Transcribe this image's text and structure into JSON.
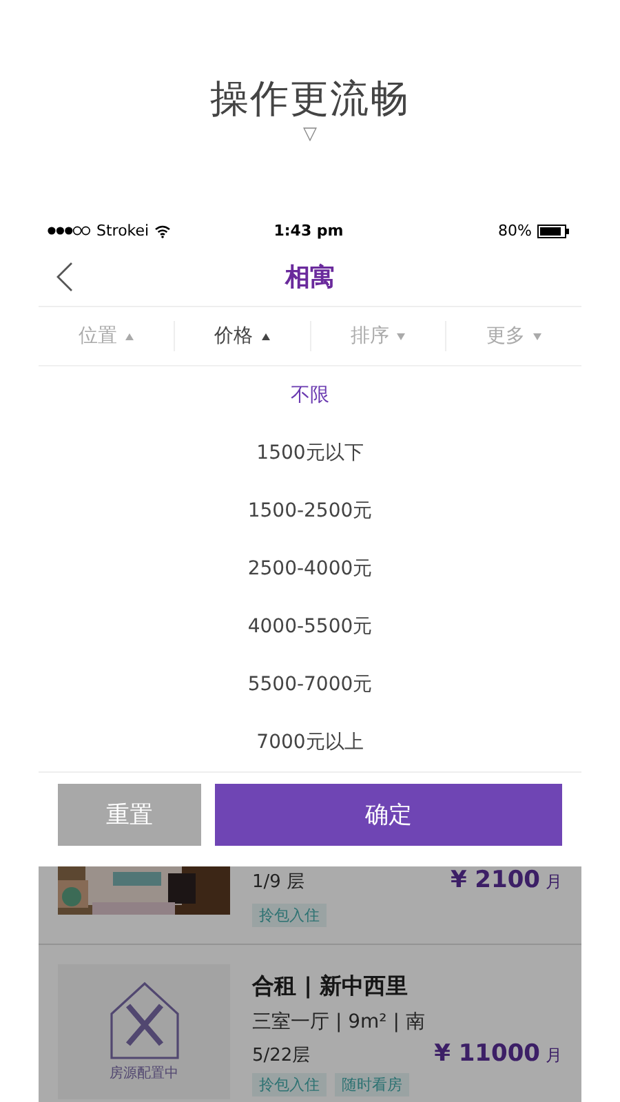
{
  "headline": {
    "title": "操作更流畅",
    "arrow": "▽"
  },
  "status_bar": {
    "carrier": "Strokei",
    "time": "1:43 pm",
    "battery": "80%"
  },
  "nav": {
    "title": "相寓"
  },
  "filters": [
    {
      "label": "位置",
      "expanded": true,
      "selected": false
    },
    {
      "label": "价格",
      "expanded": true,
      "selected": true
    },
    {
      "label": "排序",
      "expanded": false,
      "selected": false
    },
    {
      "label": "更多",
      "expanded": false,
      "selected": false
    }
  ],
  "price_options": [
    {
      "label": "不限",
      "selected": true
    },
    {
      "label": "1500元以下",
      "selected": false
    },
    {
      "label": "1500-2500元",
      "selected": false
    },
    {
      "label": "2500-4000元",
      "selected": false
    },
    {
      "label": "4000-5500元",
      "selected": false
    },
    {
      "label": "5500-7000元",
      "selected": false
    },
    {
      "label": "7000元以上",
      "selected": false
    }
  ],
  "buttons": [
    {
      "label": "重置",
      "kind": "secondary"
    },
    {
      "label": "确定",
      "kind": "primary"
    }
  ],
  "listings": [
    {
      "floor": "1/9 层",
      "price": "¥ 2100",
      "unit": "月",
      "tags": [
        "拎包入住"
      ]
    },
    {
      "kind": "placeholder",
      "placeholder_text": "房源配置中",
      "title": "合租 | 新中西里",
      "specs": "三室一厅 | 9m² | 南",
      "floor": "5/22层",
      "price": "¥ 11000",
      "unit": "月",
      "tags": [
        "拎包入住",
        "随时看房"
      ]
    }
  ]
}
